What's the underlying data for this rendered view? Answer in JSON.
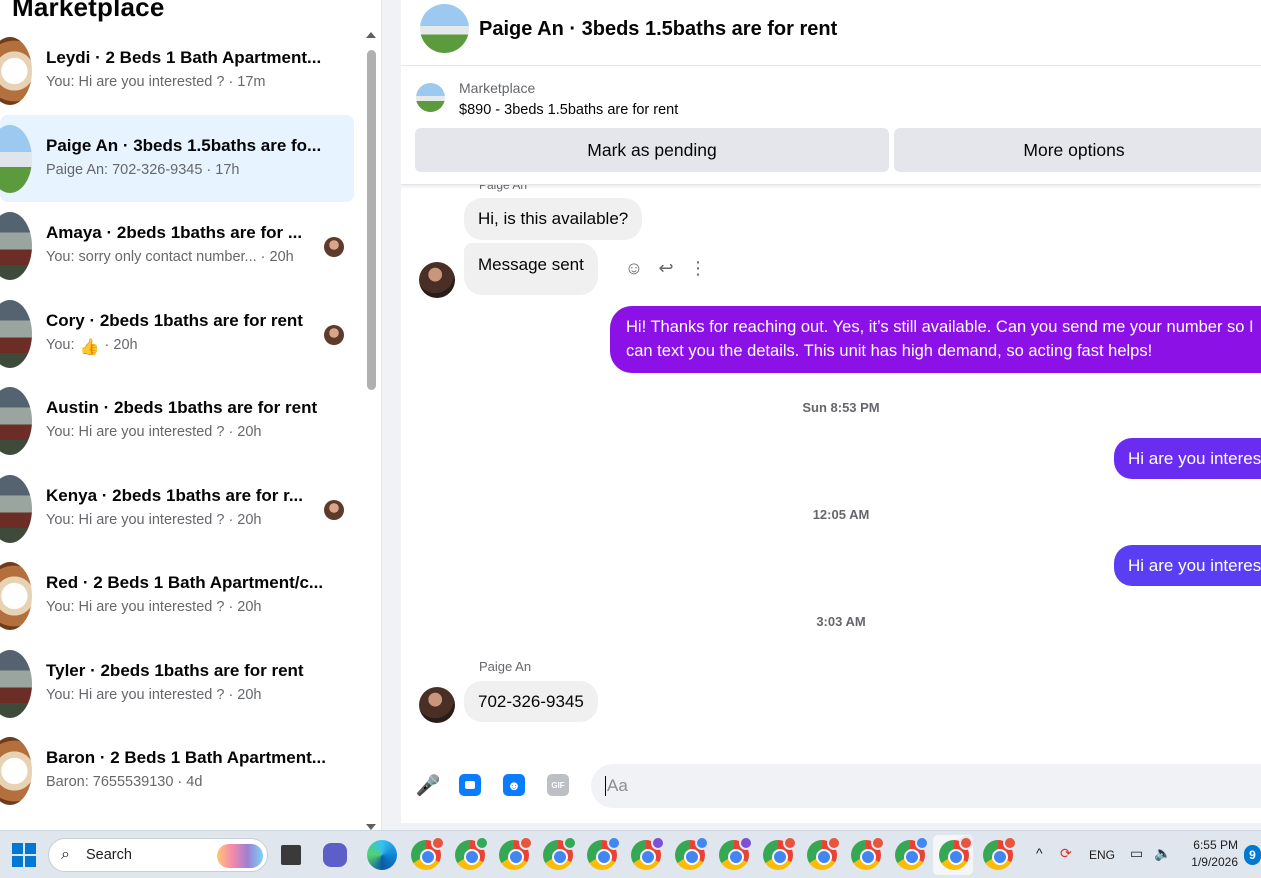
{
  "sidebar": {
    "title": "Marketplace",
    "conversations": [
      {
        "name": "Leydi · 2 Beds 1 Bath Apartment...",
        "preview": "You: Hi are you interested ? · 17m",
        "thumb": "house-brown",
        "has_avatar": false
      },
      {
        "name": "Paige An · 3beds 1.5baths are fo...",
        "preview": "Paige An: 702-326-9345 · 17h",
        "thumb": "house-sky",
        "has_avatar": false,
        "active": true
      },
      {
        "name": "Amaya · 2beds 1baths are for ...",
        "preview": "You: sorry only contact number... · 20h",
        "thumb": "house-dark",
        "has_avatar": true
      },
      {
        "name": "Cory · 2beds 1baths are for rent",
        "preview_prefix": "You: ",
        "preview_suffix": " · 20h",
        "thumb": "house-dark",
        "has_avatar": true
      },
      {
        "name": "Austin · 2beds 1baths are for rent",
        "preview": "You: Hi are you interested ? · 20h",
        "thumb": "house-dark",
        "has_avatar": false
      },
      {
        "name": "Kenya · 2beds 1baths are for r...",
        "preview": "You: Hi are you interested ? · 20h",
        "thumb": "house-dark",
        "has_avatar": true
      },
      {
        "name": "Red · 2 Beds 1 Bath Apartment/c...",
        "preview": "You: Hi are you interested ? · 20h",
        "thumb": "house-brown",
        "has_avatar": false
      },
      {
        "name": "Tyler · 2beds 1baths are for rent",
        "preview": "You: Hi are you interested ? · 20h",
        "thumb": "house-dark",
        "has_avatar": false
      },
      {
        "name": "Baron · 2 Beds 1 Bath Apartment...",
        "preview": "Baron: 7655539130 · 4d",
        "thumb": "house-brown",
        "has_avatar": false
      }
    ]
  },
  "chat": {
    "header_title": "Paige An · 3beds 1.5baths are for rent",
    "marketplace_label": "Marketplace",
    "listing": "$890 - 3beds 1.5baths are for rent",
    "mark_pending_label": "Mark as pending",
    "more_options_label": "More options",
    "sender_cut": "Paige An",
    "messages": {
      "in1": "Hi, is this available?",
      "in2": "Message sent",
      "out1": "Hi! Thanks for reaching out. Yes, it’s still available. Can you send me your number so I can text you the details. This unit has high demand, so acting fast helps!",
      "ts1": "Sun 8:53 PM",
      "out2": "Hi are you interested ?",
      "ts2": "12:05 AM",
      "out3": "Hi are you interested ?",
      "ts3": "3:03 AM",
      "sender_name": "Paige An",
      "in3": "702-326-9345"
    },
    "composer_placeholder": "Aa",
    "action_icons": [
      "emoji-icon",
      "reply-icon",
      "more-icon"
    ]
  },
  "taskbar": {
    "search_label": "Search",
    "lang": "ENG",
    "time": "6:55 PM",
    "date": "1/9/2026",
    "notification_count": "9",
    "chrome_badges": [
      "#e8553d",
      "#34a853",
      "#e8553d",
      "#34a853",
      "#4285f4",
      "#7b4fd6",
      "#4285f4",
      "#7b4fd6",
      "#e8553d",
      "#e8553d",
      "#e8553d",
      "#4285f4",
      "#e8553d",
      "#e8553d"
    ]
  }
}
